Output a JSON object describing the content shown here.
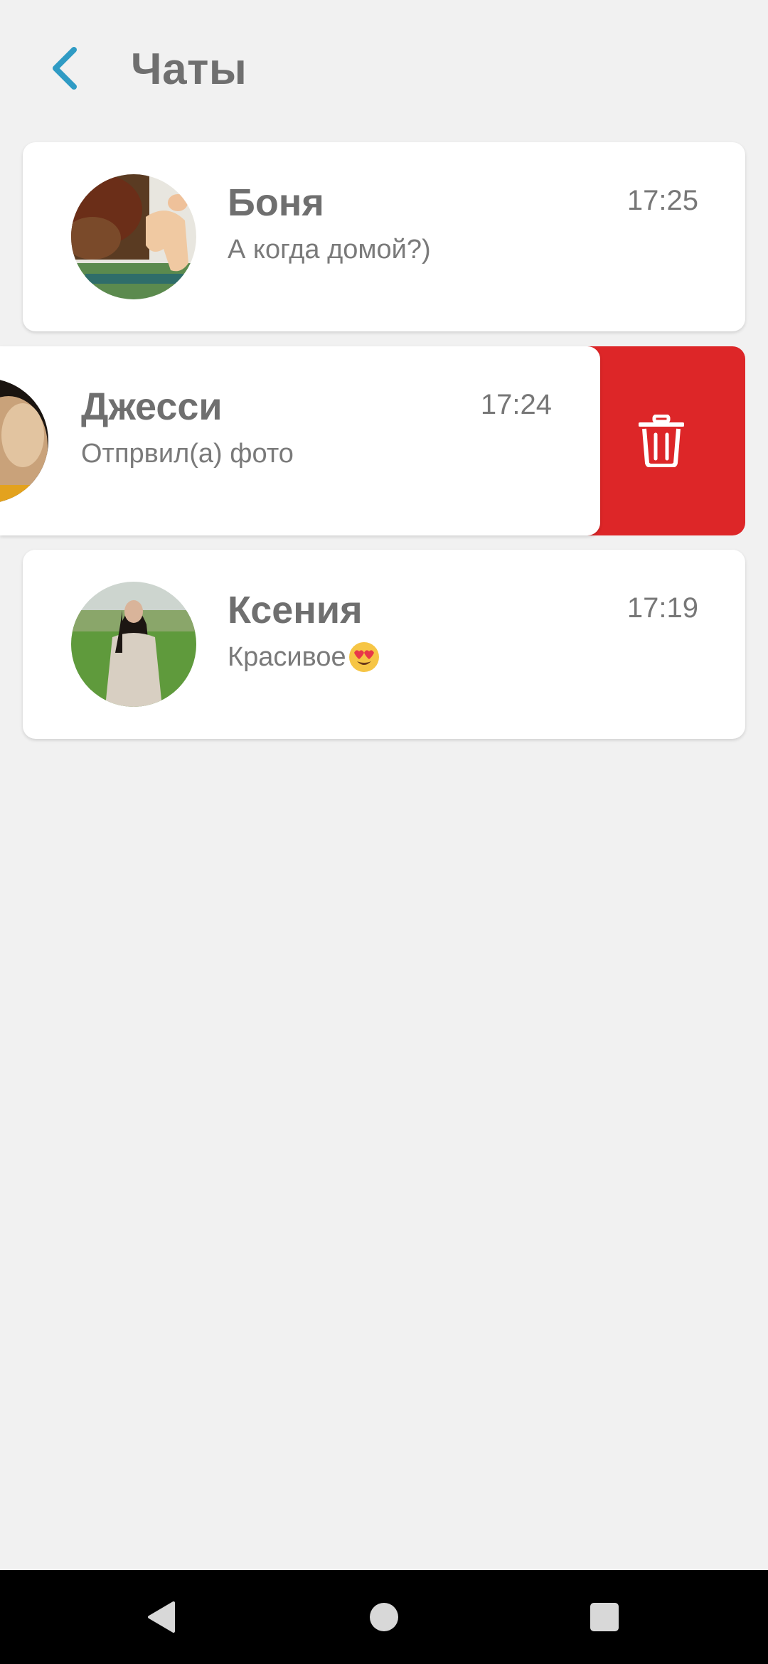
{
  "header": {
    "title": "Чаты",
    "back_icon": "chevron-left-icon",
    "accent_color": "#2f9bc4"
  },
  "chats": [
    {
      "name": "Боня",
      "time": "17:25",
      "preview": "А когда домой?)",
      "avatar": "cat-photo"
    },
    {
      "name": "Джесси",
      "time": "17:24",
      "preview": "Отпрвил(а) фото",
      "avatar": "cat-photo",
      "swiped": true
    },
    {
      "name": "Ксения",
      "time": "17:19",
      "preview": "Красивое",
      "preview_emoji": "heart-eyes-emoji",
      "avatar": "woman-photo"
    }
  ],
  "delete_action": {
    "icon": "trash-icon",
    "color": "#dd2628"
  },
  "navbar": {
    "back_icon": "nav-back-icon",
    "home_icon": "nav-home-icon",
    "recents_icon": "nav-recents-icon"
  }
}
